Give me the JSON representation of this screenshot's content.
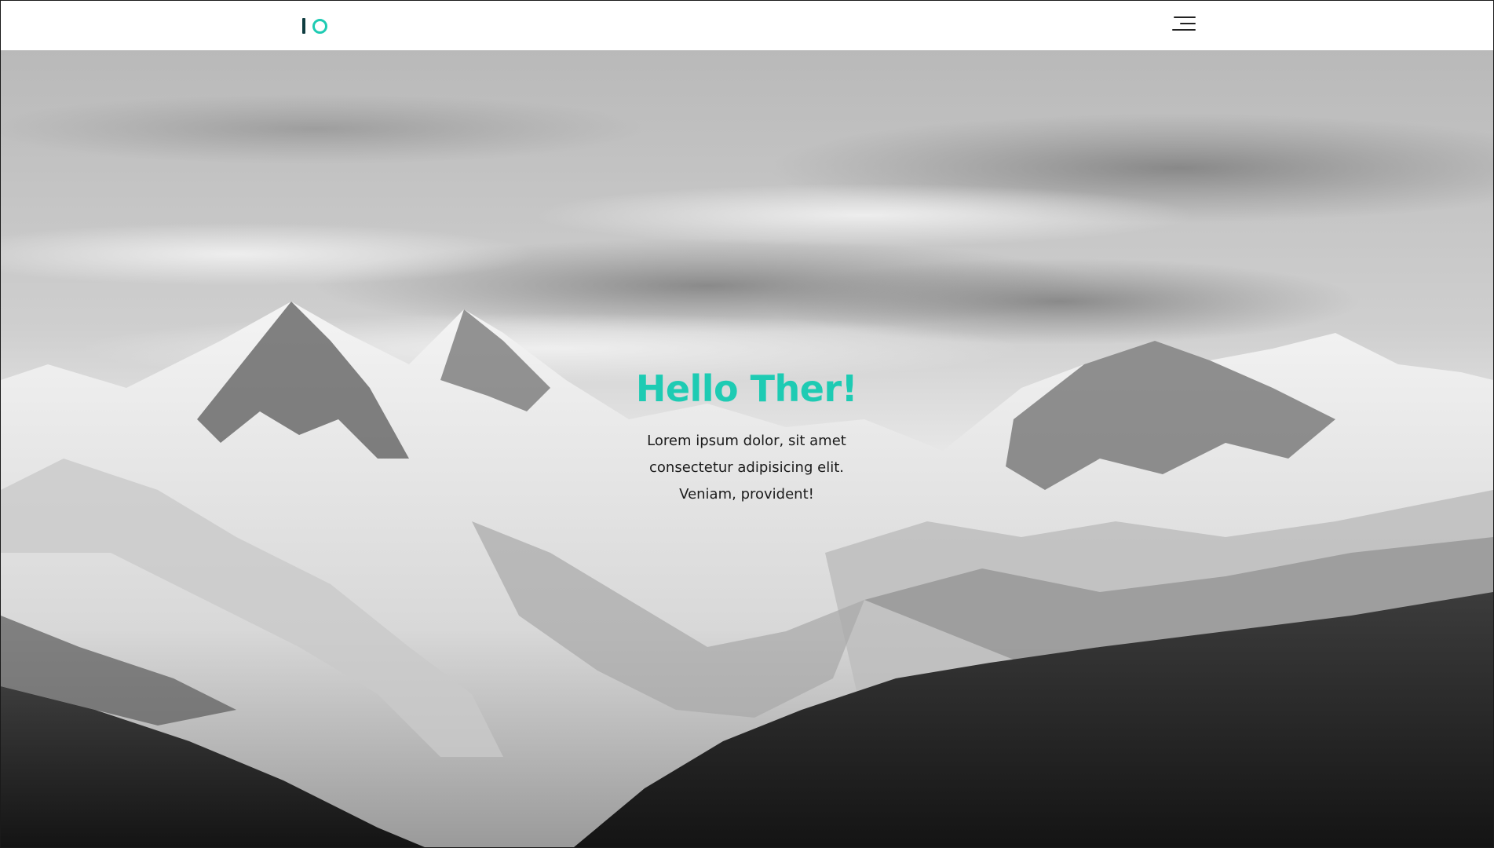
{
  "brand": {
    "logo_text": "IO",
    "accent_color": "#1ecbb3",
    "dark_color": "#0f3d40"
  },
  "nav": {
    "menu_icon": "hamburger-menu-icon"
  },
  "hero": {
    "background": "snowy mountain range under clouds (grayscale photo)",
    "title": "Hello Ther!",
    "text": "Lorem ipsum dolor, sit amet consectetur adipisicing elit. Veniam, provident!"
  }
}
